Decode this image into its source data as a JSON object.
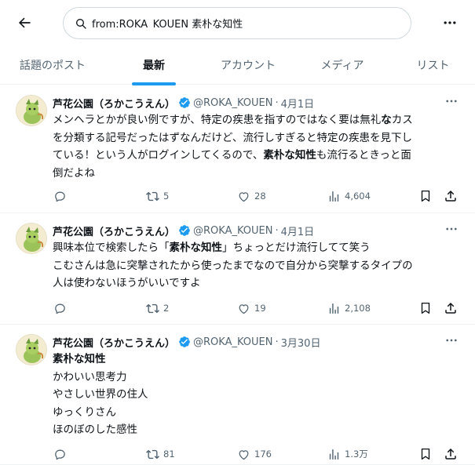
{
  "search": {
    "value": "from:ROKA_KOUEN 素朴な知性"
  },
  "tabs": [
    "話題のポスト",
    "最新",
    "アカウント",
    "メディア",
    "リスト"
  ],
  "active_tab": 1,
  "colors": {
    "accent": "#1d9bf0",
    "text": "#0f1419",
    "muted": "#536471",
    "divider": "#eff3f4"
  },
  "posts": [
    {
      "name": "芦花公園（ろかこうえん）",
      "handle": "@ROKA_KOUEN",
      "date": "4月1日",
      "lines": [
        [
          {
            "t": "メンヘラとかが良い例ですが、特定の疾患を指すのではなく要は無礼"
          },
          {
            "t": "な",
            "b": true
          },
          {
            "t": "カス"
          }
        ],
        [
          {
            "t": "を分類する記号だったはずなんだけど、流行しすぎると特定の疾患を見下し"
          }
        ],
        [
          {
            "t": "ている！という人がログインしてくるので、"
          },
          {
            "t": "素朴な知性",
            "b": true
          },
          {
            "t": "も流行るときっと面"
          }
        ],
        [
          {
            "t": "倒だよね"
          }
        ]
      ],
      "reply": "",
      "repost": "5",
      "like": "28",
      "views": "4,604"
    },
    {
      "name": "芦花公園（ろかこうえん）",
      "handle": "@ROKA_KOUEN",
      "date": "4月1日",
      "lines": [
        [
          {
            "t": "興味本位で検索したら「"
          },
          {
            "t": "素朴な知性",
            "b": true
          },
          {
            "t": "」ちょっとだけ流行してて笑う"
          }
        ],
        [
          {
            "t": "こむさんは急に突撃されたから使ったまでなので自分から突撃するタイプの"
          }
        ],
        [
          {
            "t": "人は使わないほうがいいですよ"
          }
        ]
      ],
      "reply": "",
      "repost": "2",
      "like": "19",
      "views": "2,108"
    },
    {
      "name": "芦花公園（ろかこうえん）",
      "handle": "@ROKA_KOUEN",
      "date": "3月30日",
      "lines": [
        [
          {
            "t": "素朴な知性",
            "b": true
          }
        ],
        [
          {
            "t": "かわいい思考力"
          }
        ],
        [
          {
            "t": "やさしい世界の住人"
          }
        ],
        [
          {
            "t": "ゆっくりさん"
          }
        ],
        [
          {
            "t": "ほのぼのした感性"
          }
        ]
      ],
      "reply": "",
      "repost": "81",
      "like": "176",
      "views": "1.3万"
    }
  ],
  "icons": {
    "back": "arrow-left-icon",
    "search": "search-icon",
    "more": "more-horizontal-icon",
    "verified": "verified-badge-icon",
    "reply": "reply-icon",
    "repost": "repost-icon",
    "like": "like-icon",
    "views": "views-icon",
    "bookmark": "bookmark-icon",
    "share": "share-icon"
  }
}
